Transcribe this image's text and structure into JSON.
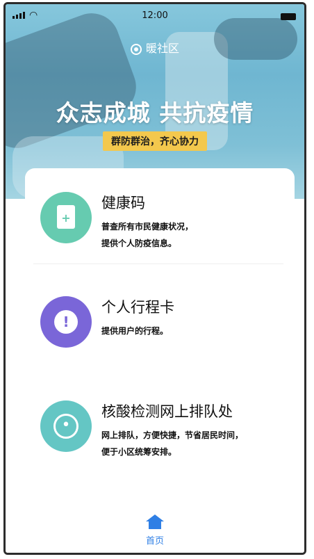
{
  "status_bar": {
    "time": "12:00"
  },
  "header": {
    "location": "暖社区",
    "slogan": "众志成城 共抗疫情",
    "tagline": "群防群治，齐心协力"
  },
  "items": [
    {
      "title": "健康码",
      "desc_line1": "普查所有市民健康状况，",
      "desc_line2": "提供个人防疫信息。",
      "icon": "document-plus-icon",
      "color": "#66cbb0"
    },
    {
      "title": "个人行程卡",
      "desc_line1": "提供用户的行程。",
      "desc_line2": "",
      "icon": "alert-badge-icon",
      "color": "#7a66d8"
    },
    {
      "title": "核酸检测网上排队处",
      "desc_line1": "网上排队，方便快捷，节省居民时间，",
      "desc_line2": "便于小区统筹安排。",
      "icon": "virus-icon",
      "color": "#64c6c4"
    }
  ],
  "tabbar": {
    "home_label": "首页",
    "accent": "#2f7fe5"
  }
}
